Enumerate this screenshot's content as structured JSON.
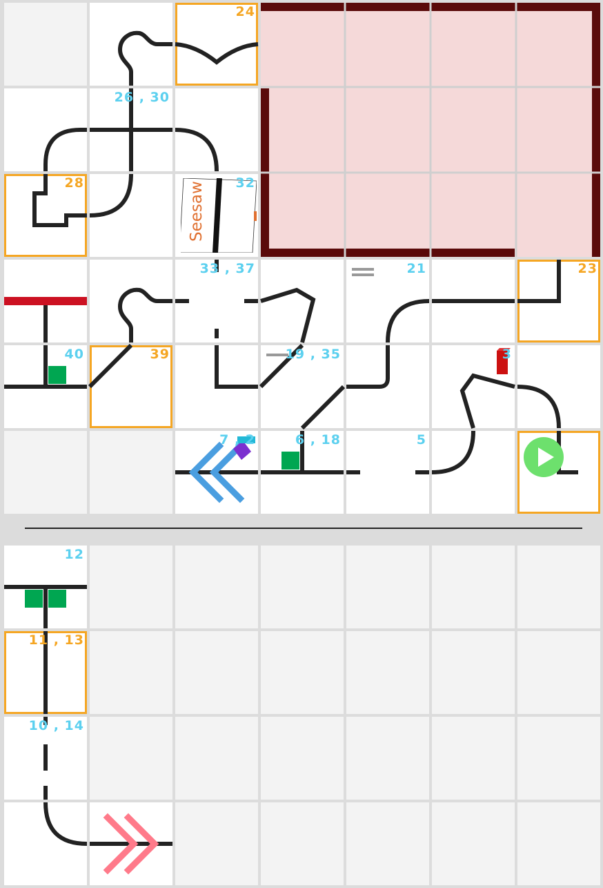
{
  "board": {
    "colors": {
      "track": "#222222",
      "badge_blue": "#5bd0ef",
      "badge_orange": "#f5a623",
      "zone_fill": "#f5d9d9",
      "zone_border": "#5a0a0a",
      "green_marker": "#00a651",
      "red_bar": "#cc1122",
      "rewind_arrows": "#4a9ee0",
      "fast_forward_arrows": "#ff7a8a",
      "play_button": "#6de06d"
    },
    "top_badges": {
      "b24": "24",
      "b26_30": "26 , 30",
      "b28": "28",
      "b32": "32",
      "b33_37": "33 , 37",
      "b21": "21",
      "b23": "23",
      "b40": "40",
      "b39": "39",
      "b19_35": "19 , 35",
      "b3": "3",
      "b7": "7 , 2",
      "b6_18": "6 , 18",
      "b5": "5"
    },
    "seesaw_label": "Seesaw",
    "bottom_badges": {
      "b12": "12",
      "b11_13": "11 , 13",
      "b10_14": "10 , 14"
    },
    "icons": [
      "rewind-icon",
      "fast-forward-icon",
      "play-icon",
      "seesaw-icon",
      "red-block-icon",
      "green-marker-icon"
    ]
  }
}
